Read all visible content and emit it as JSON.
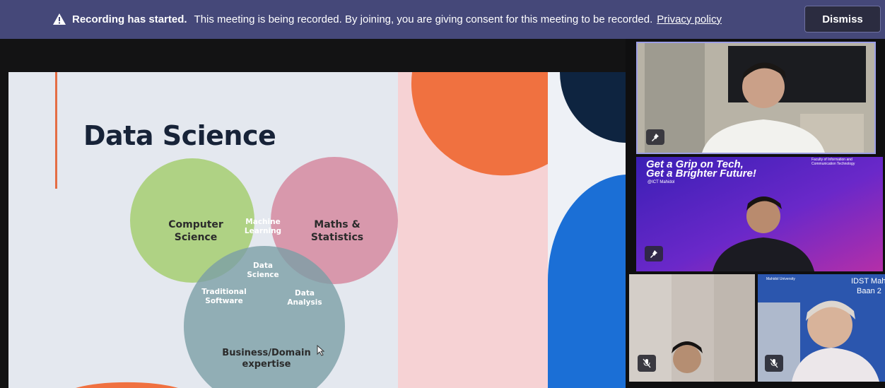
{
  "banner": {
    "strong": "Recording has started.",
    "message": "This meeting is being recorded. By joining, you are giving consent for this meeting to be recorded.",
    "link": "Privacy policy",
    "dismiss_label": "Dismiss",
    "icon": "warning-icon"
  },
  "slide": {
    "title": "Data Science",
    "venn": {
      "computer_science": "Computer\nScience",
      "maths_statistics": "Maths &\nStatistics",
      "business_domain": "Business/Domain\nexpertise",
      "machine_learning": "Machine\nLearning",
      "data_science": "Data\nScience",
      "traditional_software": "Traditional\nSoftware",
      "data_analysis": "Data\nAnalysis"
    },
    "colors": {
      "green": "#a8cf78",
      "pink": "#d68aa0",
      "teal": "#7c9fa6",
      "orange": "#f07140",
      "navy": "#0e2440",
      "blue": "#1b6fd6"
    }
  },
  "participants": {
    "tile2_headline1": "Get a Grip on Tech,",
    "tile2_headline2": "Get a Brighter Future!",
    "tile2_handle": "@ICT Mahidol",
    "tile2_faculty": "Faculty of Information and Communication Technology",
    "tile4_org": "Mahidol University",
    "tile4_fragment1": "IDST Mah",
    "tile4_fragment2": "Baan 2"
  }
}
